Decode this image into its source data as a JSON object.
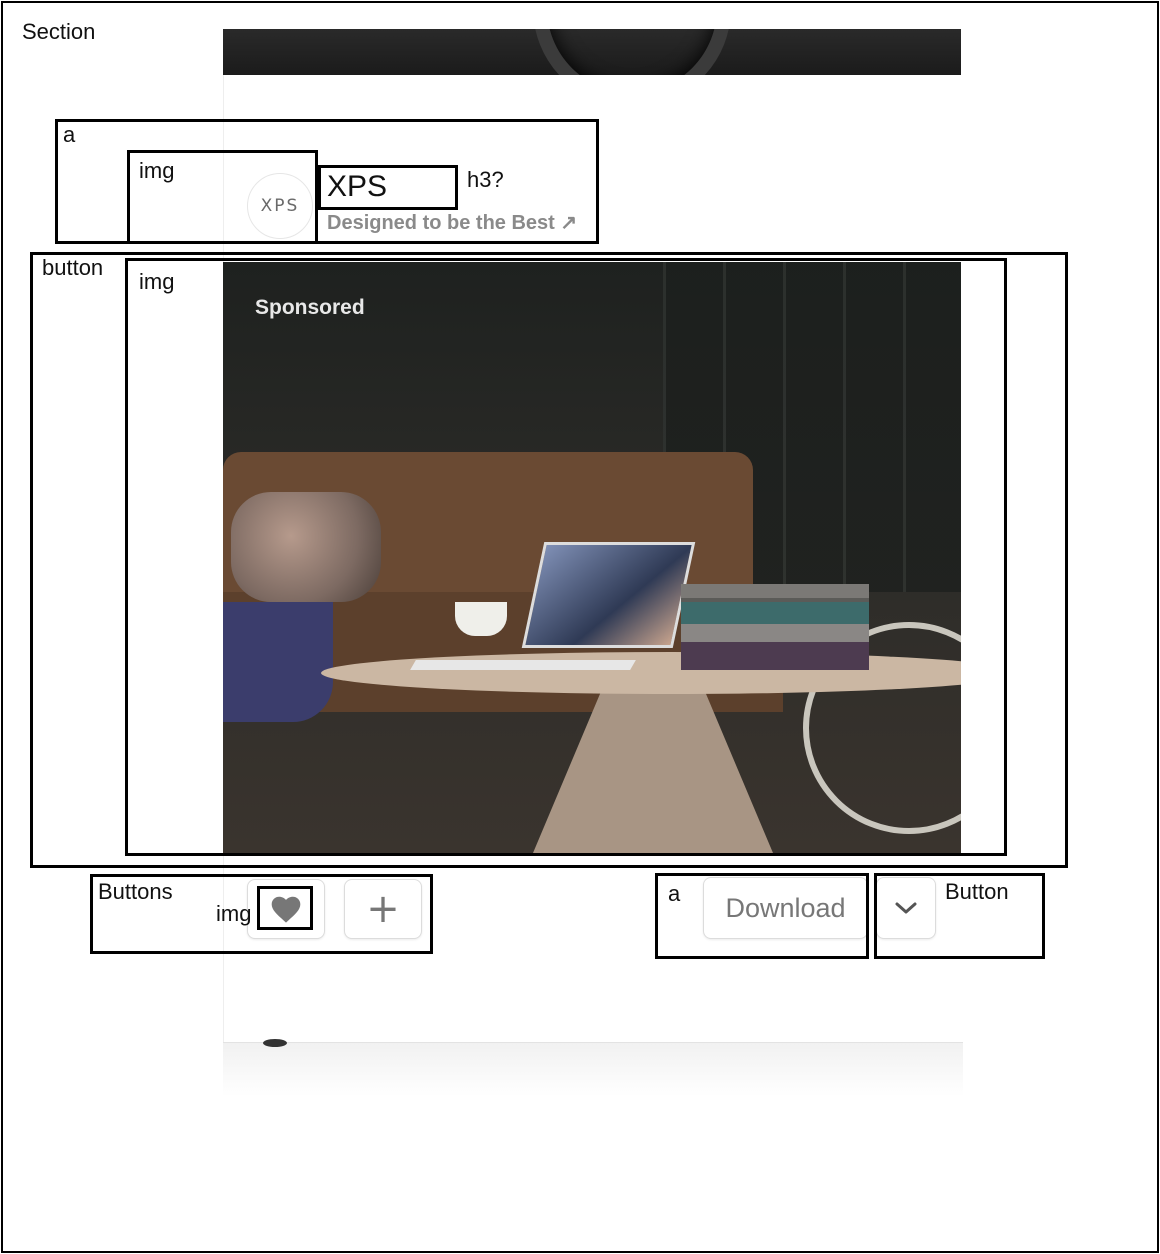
{
  "annotations": {
    "section": "Section",
    "link": "a",
    "img_avatar": "img",
    "h3": "h3?",
    "button": "button",
    "img_ad": "img",
    "buttons": "Buttons",
    "img_heart": "img",
    "link_download": "a",
    "button_chevron": "Button"
  },
  "brand": {
    "logo_text": "XPS",
    "title": "XPS",
    "subtitle": "Designed to be the Best ↗"
  },
  "ad": {
    "badge": "Sponsored"
  },
  "actions": {
    "like_icon": "heart-icon",
    "collect_icon": "plus-icon",
    "plus_glyph": "+",
    "download_label": "Download",
    "more_icon": "chevron-down-icon"
  }
}
